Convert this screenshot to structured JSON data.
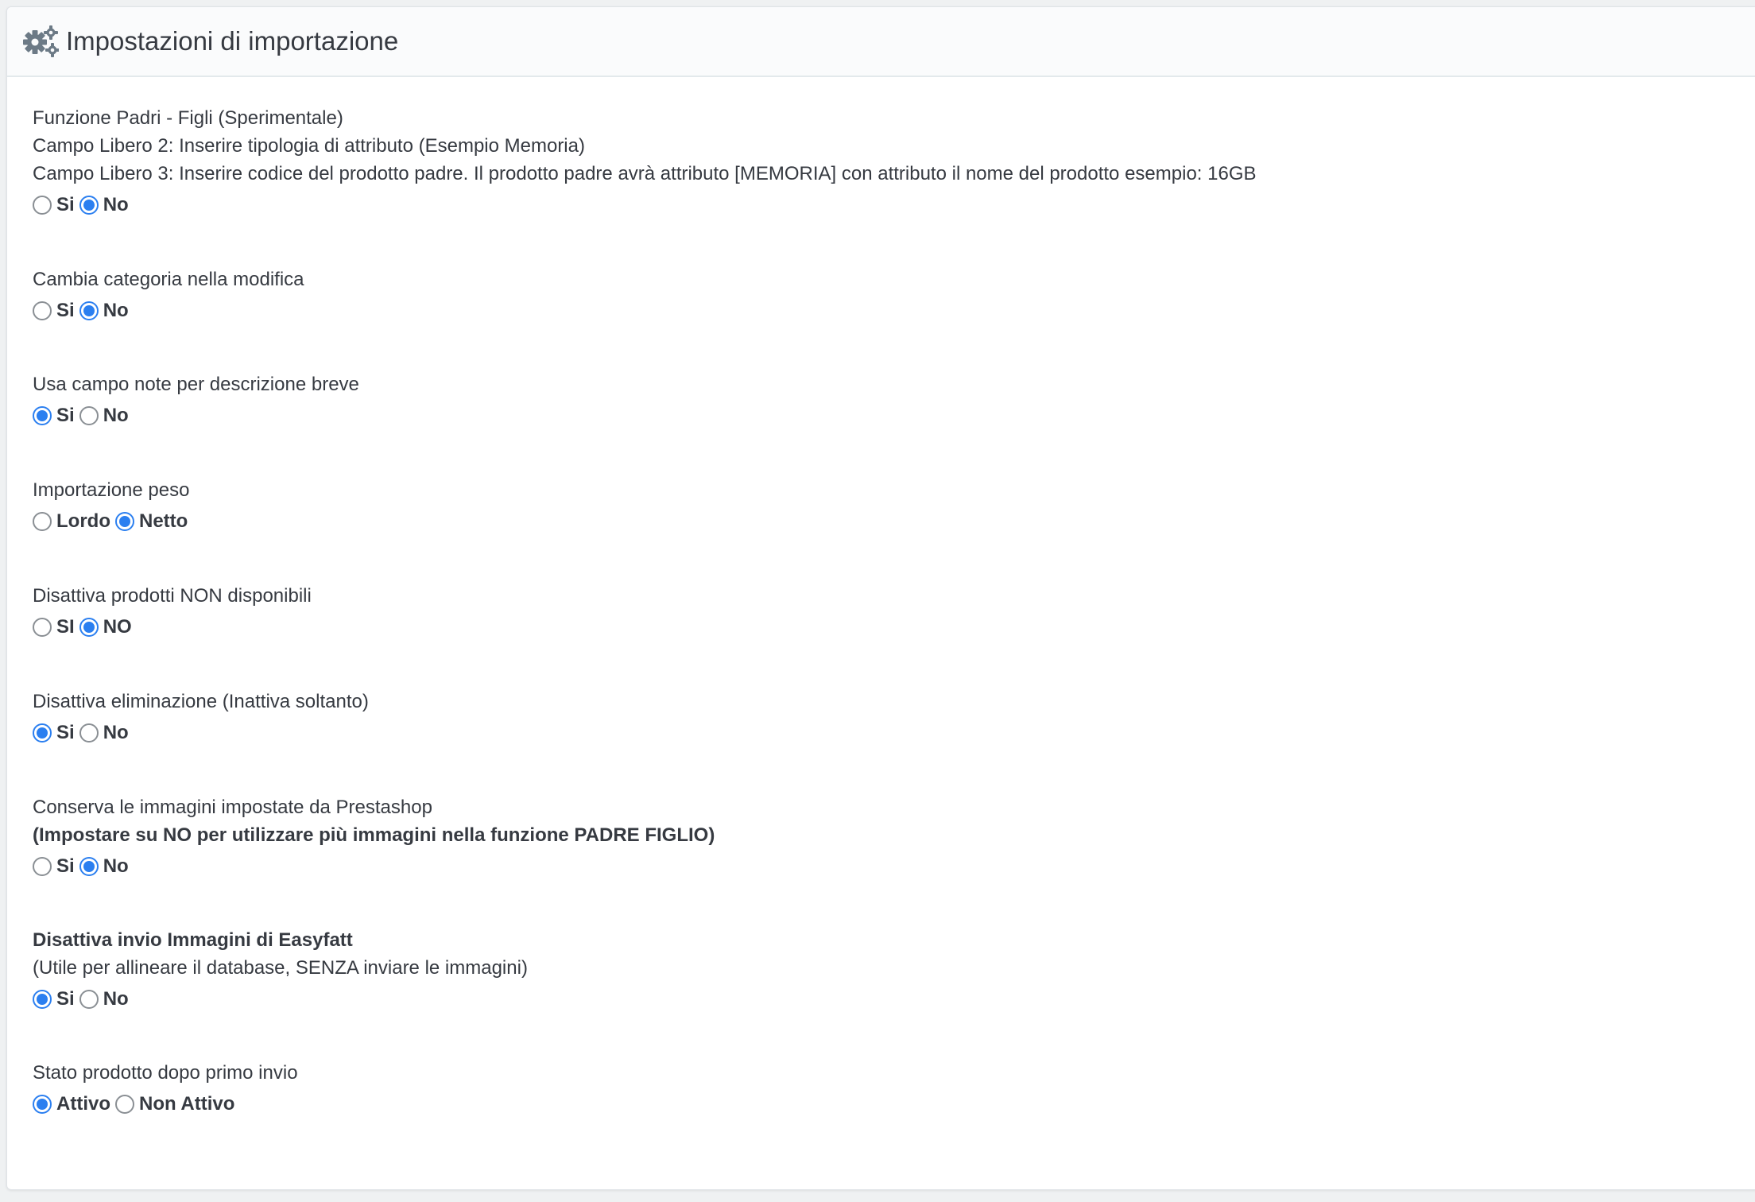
{
  "panel": {
    "title": "Impostazioni di importazione",
    "icon": "gears-icon"
  },
  "settings": [
    {
      "lines": [
        {
          "text": "Funzione Padri - Figli (Sperimentale)",
          "bold": false
        },
        {
          "text": "Campo Libero 2: Inserire tipologia di attributo (Esempio Memoria)",
          "bold": false
        },
        {
          "text": "Campo Libero 3: Inserire codice del prodotto padre. Il prodotto padre avrà attributo [MEMORIA] con attributo il nome del prodotto esempio: 16GB",
          "bold": false
        }
      ],
      "options": [
        {
          "label": "Si",
          "checked": false
        },
        {
          "label": "No",
          "checked": true
        }
      ]
    },
    {
      "lines": [
        {
          "text": "Cambia categoria nella modifica",
          "bold": false
        }
      ],
      "options": [
        {
          "label": "Si",
          "checked": false
        },
        {
          "label": "No",
          "checked": true
        }
      ]
    },
    {
      "lines": [
        {
          "text": "Usa campo note per descrizione breve",
          "bold": false
        }
      ],
      "options": [
        {
          "label": "Si",
          "checked": true
        },
        {
          "label": "No",
          "checked": false
        }
      ]
    },
    {
      "lines": [
        {
          "text": "Importazione peso",
          "bold": false
        }
      ],
      "options": [
        {
          "label": "Lordo",
          "checked": false
        },
        {
          "label": "Netto",
          "checked": true
        }
      ]
    },
    {
      "lines": [
        {
          "text": "Disattiva prodotti NON disponibili",
          "bold": false
        }
      ],
      "options": [
        {
          "label": "SI",
          "checked": false
        },
        {
          "label": "NO",
          "checked": true
        }
      ]
    },
    {
      "lines": [
        {
          "text": "Disattiva eliminazione (Inattiva soltanto)",
          "bold": false
        }
      ],
      "options": [
        {
          "label": "Si",
          "checked": true
        },
        {
          "label": "No",
          "checked": false
        }
      ]
    },
    {
      "lines": [
        {
          "text": "Conserva le immagini impostate da Prestashop",
          "bold": false
        },
        {
          "text": "(Impostare su NO per utilizzare più immagini nella funzione PADRE FIGLIO)",
          "bold": true
        }
      ],
      "options": [
        {
          "label": "Si",
          "checked": false
        },
        {
          "label": "No",
          "checked": true
        }
      ]
    },
    {
      "lines": [
        {
          "text": "Disattiva invio Immagini di Easyfatt",
          "bold": true
        },
        {
          "text": "(Utile per allineare il database, SENZA inviare le immagini)",
          "bold": false
        }
      ],
      "options": [
        {
          "label": "Si",
          "checked": true
        },
        {
          "label": "No",
          "checked": false
        }
      ]
    },
    {
      "lines": [
        {
          "text": "Stato prodotto dopo primo invio",
          "bold": false
        }
      ],
      "options": [
        {
          "label": "Attivo",
          "checked": true
        },
        {
          "label": "Non Attivo",
          "checked": false
        }
      ]
    }
  ],
  "colors": {
    "accent": "#2b7ff0",
    "text": "#363a41"
  }
}
